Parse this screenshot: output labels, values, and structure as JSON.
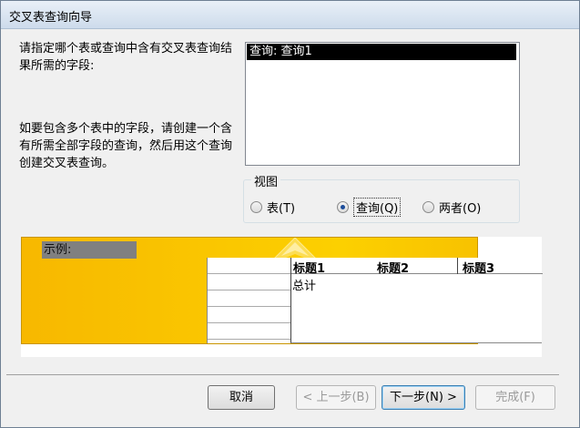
{
  "window": {
    "title": "交叉表查询向导"
  },
  "instructions": {
    "line1": "请指定哪个表或查询中含有交叉表查询结果所需的字段:",
    "line2": "如要包含多个表中的字段，请创建一个含有所需全部字段的查询，然后用这个查询创建交叉表查询。"
  },
  "listbox": {
    "items": [
      "查询: 查询1"
    ],
    "selected_index": 0
  },
  "view": {
    "legend": "视图",
    "options": [
      {
        "label": "表(T)",
        "selected": false
      },
      {
        "label": "查询(Q)",
        "selected": true
      },
      {
        "label": "两者(O)",
        "selected": false
      }
    ]
  },
  "example": {
    "title": "示例:",
    "headers": [
      "标题1",
      "标题2",
      "标题3"
    ],
    "total_label": "总计"
  },
  "buttons": {
    "cancel": "取消",
    "back": "< 上一步(B)",
    "next": "下一步(N) >",
    "finish": "完成(F)"
  }
}
